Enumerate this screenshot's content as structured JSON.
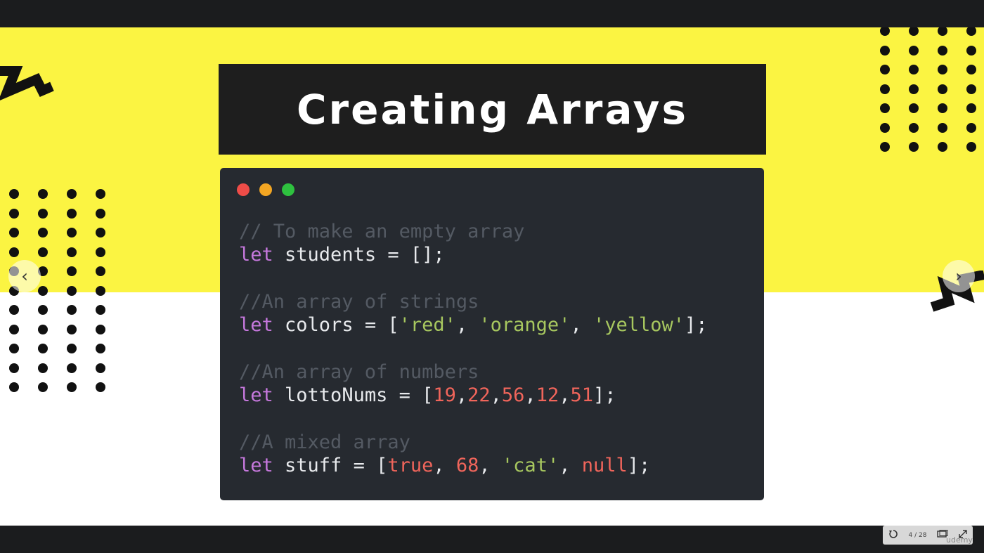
{
  "slide": {
    "title": "Creating Arrays",
    "code_lines": [
      {
        "segments": [
          {
            "t": "// To make an empty array",
            "c": "comment"
          }
        ]
      },
      {
        "segments": [
          {
            "t": "let",
            "c": "kw"
          },
          {
            "t": " students = [];",
            "c": "plain"
          }
        ]
      },
      {
        "gap": true
      },
      {
        "segments": [
          {
            "t": "//An array of strings",
            "c": "comment"
          }
        ]
      },
      {
        "segments": [
          {
            "t": "let",
            "c": "kw"
          },
          {
            "t": " colors = [",
            "c": "plain"
          },
          {
            "t": "'red'",
            "c": "str"
          },
          {
            "t": ", ",
            "c": "plain"
          },
          {
            "t": "'orange'",
            "c": "str"
          },
          {
            "t": ", ",
            "c": "plain"
          },
          {
            "t": "'yellow'",
            "c": "str"
          },
          {
            "t": "];",
            "c": "plain"
          }
        ]
      },
      {
        "gap": true
      },
      {
        "segments": [
          {
            "t": "//An array of numbers",
            "c": "comment"
          }
        ]
      },
      {
        "segments": [
          {
            "t": "let",
            "c": "kw"
          },
          {
            "t": " lottoNums = [",
            "c": "plain"
          },
          {
            "t": "19",
            "c": "num"
          },
          {
            "t": ",",
            "c": "plain"
          },
          {
            "t": "22",
            "c": "num"
          },
          {
            "t": ",",
            "c": "plain"
          },
          {
            "t": "56",
            "c": "num"
          },
          {
            "t": ",",
            "c": "plain"
          },
          {
            "t": "12",
            "c": "num"
          },
          {
            "t": ",",
            "c": "plain"
          },
          {
            "t": "51",
            "c": "num"
          },
          {
            "t": "];",
            "c": "plain"
          }
        ]
      },
      {
        "gap": true
      },
      {
        "segments": [
          {
            "t": "//A mixed array",
            "c": "comment"
          }
        ]
      },
      {
        "segments": [
          {
            "t": "let",
            "c": "kw"
          },
          {
            "t": " stuff = [",
            "c": "plain"
          },
          {
            "t": "true",
            "c": "num"
          },
          {
            "t": ", ",
            "c": "plain"
          },
          {
            "t": "68",
            "c": "num"
          },
          {
            "t": ", ",
            "c": "plain"
          },
          {
            "t": "'cat'",
            "c": "str"
          },
          {
            "t": ", ",
            "c": "plain"
          },
          {
            "t": "null",
            "c": "num"
          },
          {
            "t": "];",
            "c": "plain"
          }
        ]
      }
    ]
  },
  "navigation": {
    "prev_icon": "chevron-left-icon",
    "prev_glyph": "‹",
    "next_icon": "chevron-right-icon",
    "next_glyph": "›"
  },
  "player": {
    "page_counter": "4 / 28",
    "watermark": "udemy"
  },
  "colors": {
    "yellow": "#fbf442",
    "title_bg": "#1e1e1e",
    "code_bg": "#262a30",
    "keyword": "#c678dd",
    "string": "#a7c75f",
    "number": "#f0655b",
    "comment": "#545a63"
  }
}
